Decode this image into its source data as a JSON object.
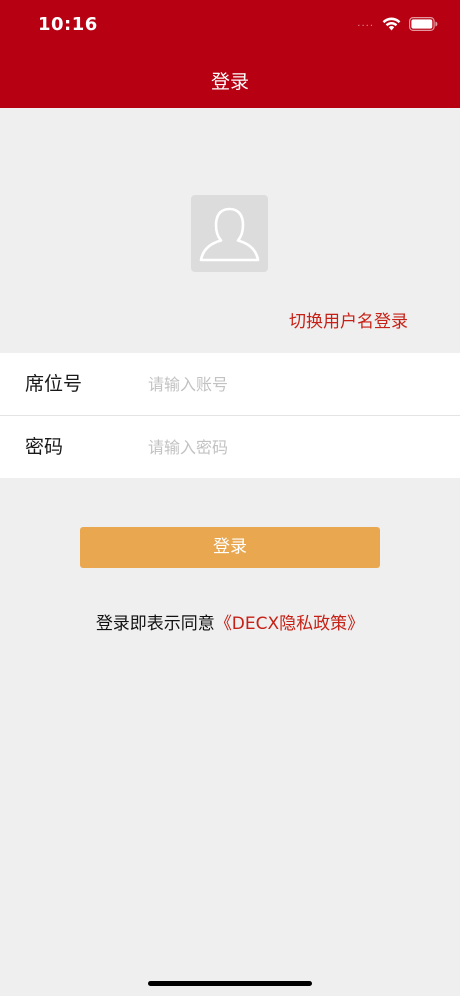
{
  "status_bar": {
    "time": "10:16",
    "signal_dots": "....",
    "icons": [
      "wifi-icon",
      "battery-icon"
    ]
  },
  "header": {
    "title": "登录",
    "background_color": "#b70012"
  },
  "avatar": {
    "icon": "user-avatar-placeholder-icon"
  },
  "switch_link": "切换用户名登录",
  "form": {
    "seat": {
      "label": "席位号",
      "placeholder": "请输入账号",
      "value": ""
    },
    "password": {
      "label": "密码",
      "placeholder": "请输入密码",
      "value": ""
    }
  },
  "login_button": {
    "label": "登录",
    "color": "#e9a850"
  },
  "policy": {
    "prefix": "登录即表示同意",
    "link": "《DECX隐私政策》",
    "link_color": "#c62116"
  }
}
